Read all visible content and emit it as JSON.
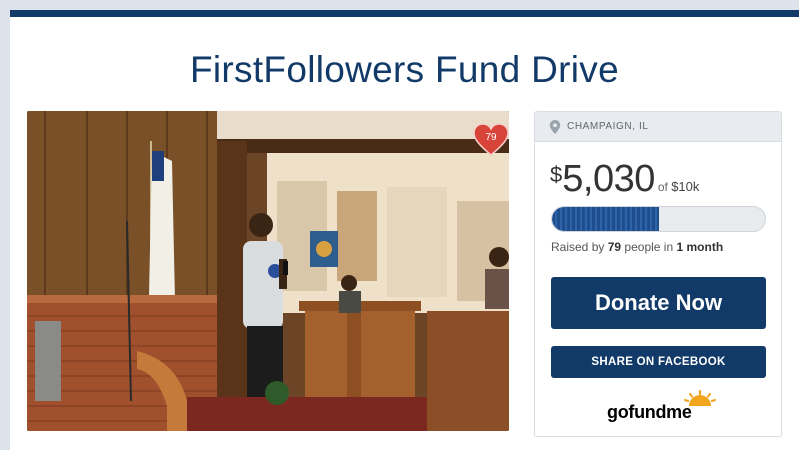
{
  "page": {
    "title": "FirstFollowers Fund Drive"
  },
  "photo": {
    "heart_count": "79",
    "accent": "#d9443a"
  },
  "campaign": {
    "location": "CHAMPAIGN, IL",
    "currency_symbol": "$",
    "amount_raised": "5,030",
    "goal_prefix": "of",
    "goal": "$10k",
    "progress_fraction": 0.503,
    "raised_prefix": "Raised by",
    "donor_count": "79",
    "people_label": "people in",
    "duration": "1 month"
  },
  "actions": {
    "donate_label": "Donate Now",
    "share_label": "SHARE ON FACEBOOK"
  },
  "brand": {
    "logo_text": "gofundme",
    "primary_color": "#123a68",
    "sun_color": "#f2a51e"
  },
  "icons": {
    "location": "map-pin-icon",
    "heart": "heart-icon"
  }
}
